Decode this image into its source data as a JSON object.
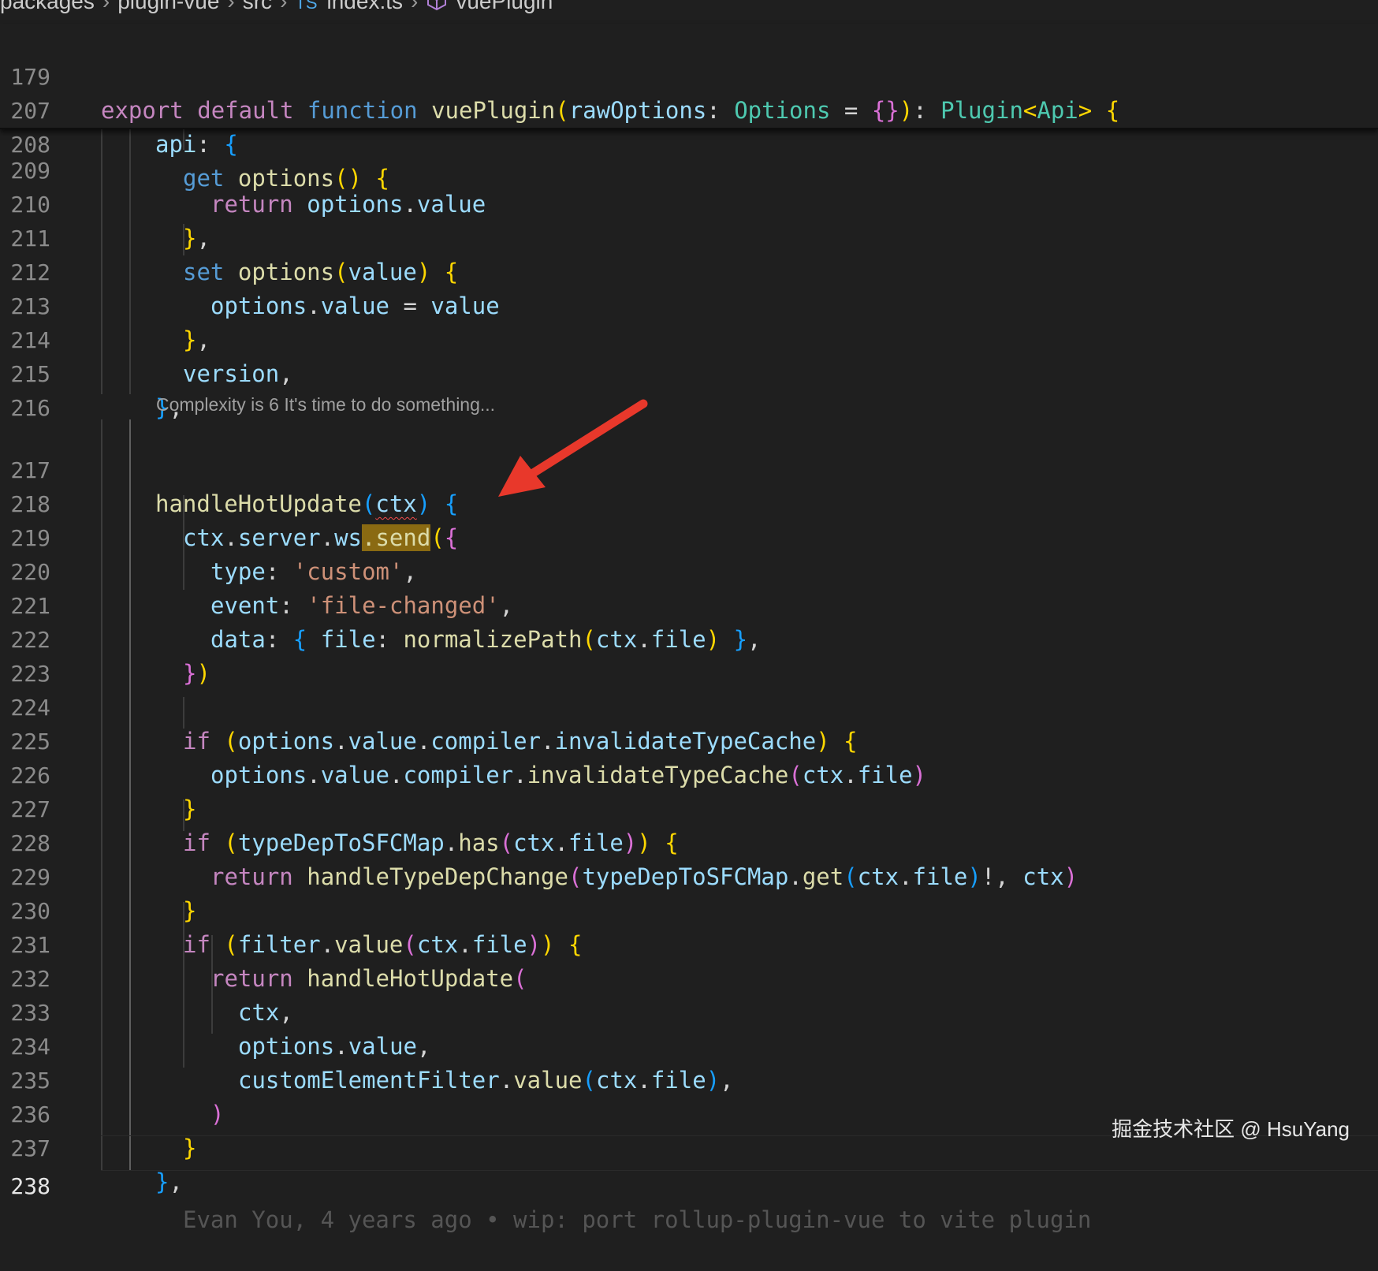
{
  "breadcrumb": {
    "items": [
      "packages",
      "plugin-vue",
      "src",
      "index.ts",
      "vuePlugin"
    ],
    "file_badge": "TS"
  },
  "codelens": "Complexity is 6 It's time to do something...",
  "blame": "Evan You, 4 years ago • wip: port rollup-plugin-vue to vite plugin",
  "watermark": "掘金技术社区 @ HsuYang",
  "line_numbers": {
    "l179": "179",
    "l207": "207",
    "l208": "208",
    "l209": "209",
    "l210": "210",
    "l211": "211",
    "l212": "212",
    "l213": "213",
    "l214": "214",
    "l215": "215",
    "l216": "216",
    "l217": "217",
    "l218": "218",
    "l219": "219",
    "l220": "220",
    "l221": "221",
    "l222": "222",
    "l223": "223",
    "l224": "224",
    "l225": "225",
    "l226": "226",
    "l227": "227",
    "l228": "228",
    "l229": "229",
    "l230": "230",
    "l231": "231",
    "l232": "232",
    "l233": "233",
    "l234": "234",
    "l235": "235",
    "l236": "236",
    "l237": "237",
    "l238": "238"
  },
  "code": {
    "l179": {
      "t1": "export",
      "t2": "default",
      "t3": "function",
      "t4": "vuePlugin",
      "t5": "(",
      "t6": "rawOptions",
      "t7": ": ",
      "t8": "Options",
      "t9": " = ",
      "t10": "{}",
      "t11": ")",
      "t12": ": ",
      "t13": "Plugin",
      "t14": "<",
      "t15": "Api",
      "t16": ">",
      "t17": "{"
    },
    "l207": {
      "t1": "api",
      "t2": ": ",
      "t3": "{"
    },
    "l208": {
      "t1": "get",
      "t2": "options",
      "t3": "()",
      "t4": "{"
    },
    "l209": {
      "t1": "return",
      "t2": "options",
      "t3": ".",
      "t4": "value"
    },
    "l210": {
      "t1": "}",
      "t2": ","
    },
    "l211": {
      "t1": "set",
      "t2": "options",
      "t3": "(",
      "t4": "value",
      "t5": ")",
      "t6": "{"
    },
    "l212": {
      "t1": "options",
      "t2": ".",
      "t3": "value",
      "t4": " = ",
      "t5": "value"
    },
    "l213": {
      "t1": "}",
      "t2": ","
    },
    "l214": {
      "t1": "version",
      "t2": ","
    },
    "l215": {
      "t1": "}",
      "t2": ","
    },
    "l217": {
      "t1": "handleHotUpdate",
      "t2": "(",
      "t3": "ctx",
      "t4": ")",
      "t5": "{"
    },
    "l218": {
      "t1": "ctx",
      "t2": ".",
      "t3": "server",
      "t4": ".",
      "t5": "ws",
      "t6": ".send",
      "t7": "(",
      "t8": "{"
    },
    "l219": {
      "t1": "type",
      "t2": ": ",
      "t3": "'custom'",
      "t4": ","
    },
    "l220": {
      "t1": "event",
      "t2": ": ",
      "t3": "'file-changed'",
      "t4": ","
    },
    "l221": {
      "t1": "data",
      "t2": ": ",
      "t3": "{",
      "t4": "file",
      "t5": ": ",
      "t6": "normalizePath",
      "t7": "(",
      "t8": "ctx",
      "t9": ".",
      "t10": "file",
      "t11": ")",
      "t12": "}",
      "t13": ","
    },
    "l222": {
      "t1": "}",
      "t2": ")"
    },
    "l224": {
      "t1": "if",
      "t2": "(",
      "t3": "options",
      "t4": ".",
      "t5": "value",
      "t6": ".",
      "t7": "compiler",
      "t8": ".",
      "t9": "invalidateTypeCache",
      "t10": ")",
      "t11": "{"
    },
    "l225": {
      "t1": "options",
      "t2": ".",
      "t3": "value",
      "t4": ".",
      "t5": "compiler",
      "t6": ".",
      "t7": "invalidateTypeCache",
      "t8": "(",
      "t9": "ctx",
      "t10": ".",
      "t11": "file",
      "t12": ")"
    },
    "l226": {
      "t1": "}"
    },
    "l227": {
      "t1": "if",
      "t2": "(",
      "t3": "typeDepToSFCMap",
      "t4": ".",
      "t5": "has",
      "t6": "(",
      "t7": "ctx",
      "t8": ".",
      "t9": "file",
      "t10": ")",
      "t11": ")",
      "t12": "{"
    },
    "l228": {
      "t1": "return",
      "t2": "handleTypeDepChange",
      "t3": "(",
      "t4": "typeDepToSFCMap",
      "t5": ".",
      "t6": "get",
      "t7": "(",
      "t8": "ctx",
      "t9": ".",
      "t10": "file",
      "t11": ")",
      "t12": "!, ",
      "t13": "ctx",
      "t14": ")"
    },
    "l229": {
      "t1": "}"
    },
    "l230": {
      "t1": "if",
      "t2": "(",
      "t3": "filter",
      "t4": ".",
      "t5": "value",
      "t6": "(",
      "t7": "ctx",
      "t8": ".",
      "t9": "file",
      "t10": ")",
      "t11": ")",
      "t12": "{"
    },
    "l231": {
      "t1": "return",
      "t2": "handleHotUpdate",
      "t3": "("
    },
    "l232": {
      "t1": "ctx",
      "t2": ","
    },
    "l233": {
      "t1": "options",
      "t2": ".",
      "t3": "value",
      "t4": ","
    },
    "l234": {
      "t1": "customElementFilter",
      "t2": ".",
      "t3": "value",
      "t4": "(",
      "t5": "ctx",
      "t6": ".",
      "t7": "file",
      "t8": ")",
      "t9": ","
    },
    "l235": {
      "t1": ")"
    },
    "l236": {
      "t1": "}"
    },
    "l237": {
      "t1": "}",
      "t2": ","
    }
  },
  "colors": {
    "background": "#1f1f1f",
    "keyword": "#c586c0",
    "storage": "#569cd6",
    "function": "#dcdcaa",
    "variable": "#9cdcfe",
    "type": "#4ec9b0",
    "string": "#ce9178",
    "bracket1": "#ffd700",
    "bracket2": "#da70d6",
    "bracket3": "#179fff",
    "find_highlight": "#8a6a12",
    "annotation_arrow": "#e8382b"
  },
  "icons": {
    "file_type": "typescript-icon",
    "symbol": "cube-icon",
    "annotation": "red-arrow-icon"
  }
}
